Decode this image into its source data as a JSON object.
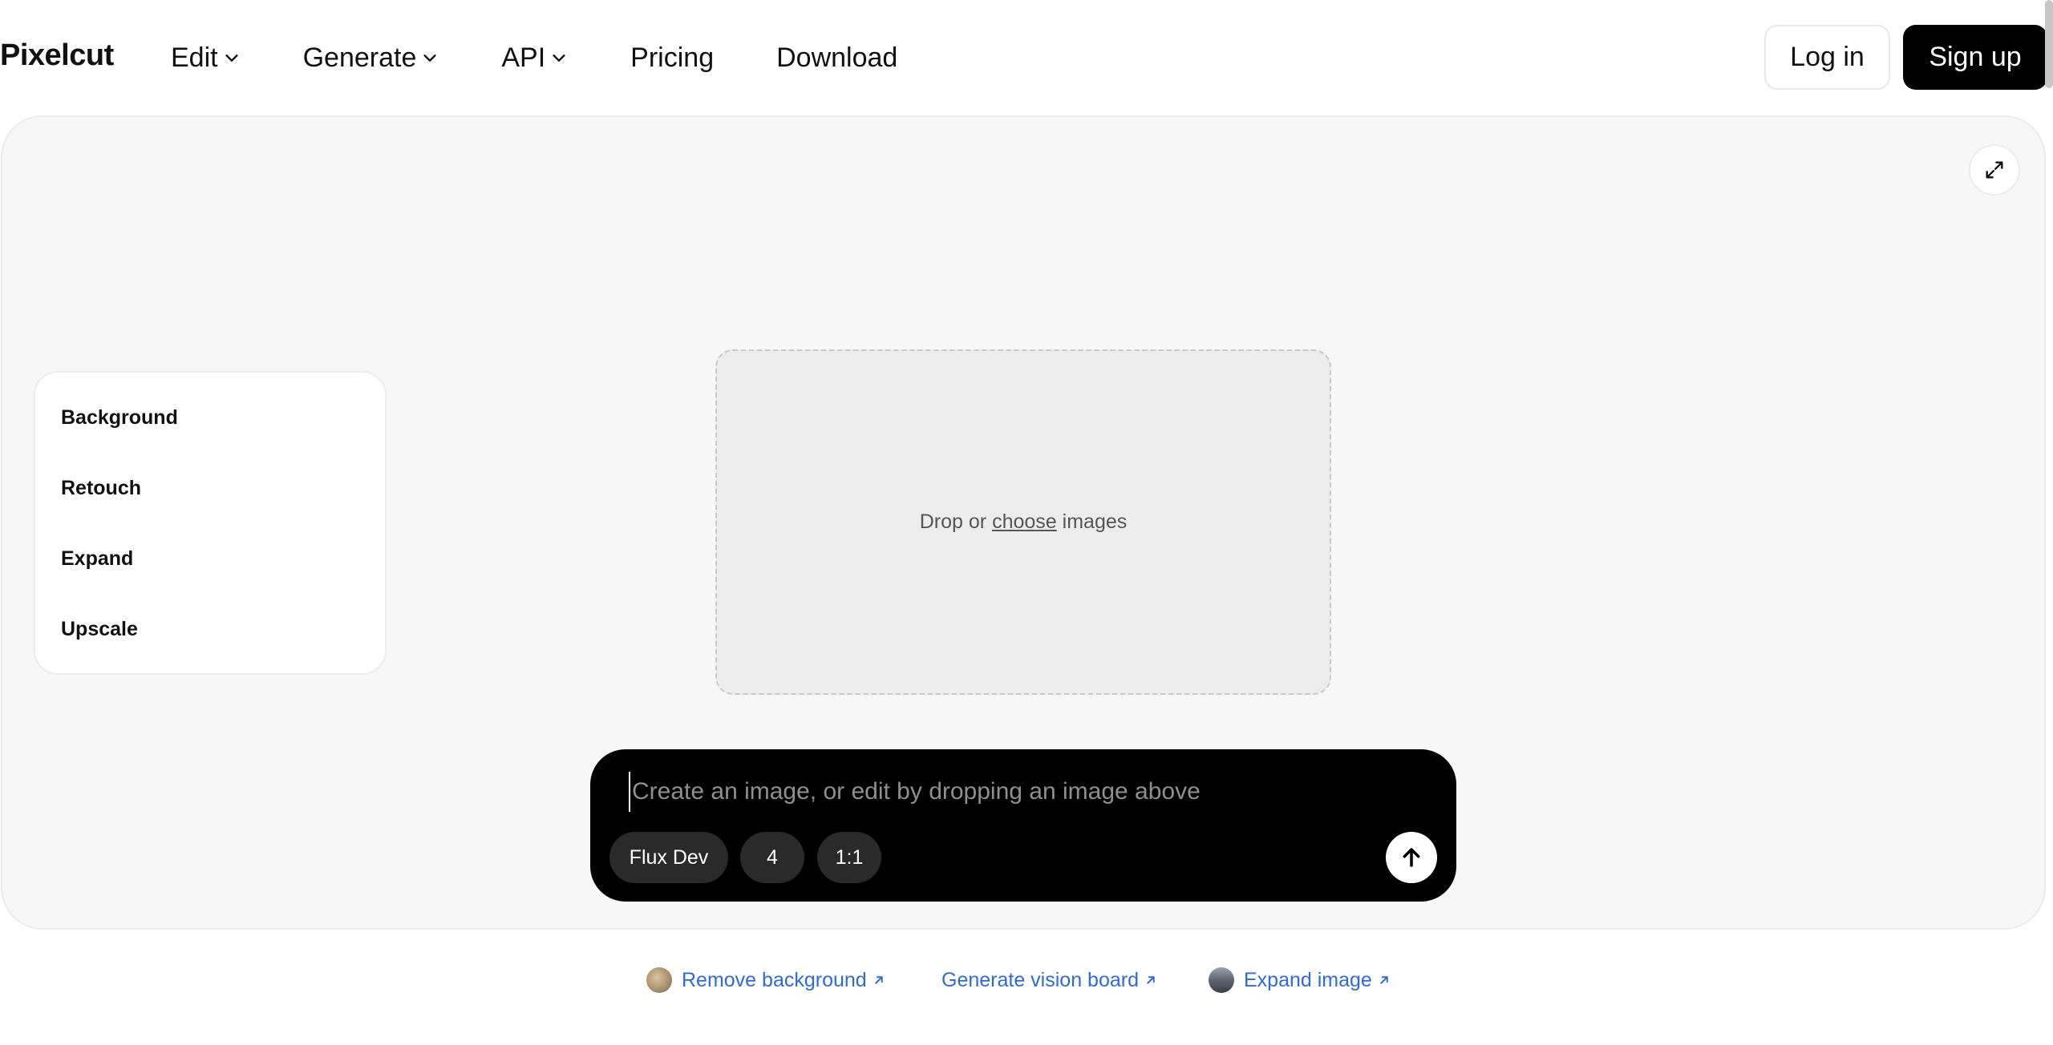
{
  "header": {
    "logo": "Pixelcut",
    "nav": [
      {
        "label": "Edit",
        "has_dropdown": true
      },
      {
        "label": "Generate",
        "has_dropdown": true
      },
      {
        "label": "API",
        "has_dropdown": true
      },
      {
        "label": "Pricing",
        "has_dropdown": false
      },
      {
        "label": "Download",
        "has_dropdown": false
      }
    ],
    "login_label": "Log in",
    "signup_label": "Sign up"
  },
  "workspace": {
    "expand_icon": "expand-arrows-icon",
    "tools": [
      "Background",
      "Retouch",
      "Expand",
      "Upscale"
    ],
    "dropzone": {
      "prefix": "Drop or",
      "link": "choose",
      "suffix": "images"
    }
  },
  "prompt": {
    "placeholder": "Create an image, or edit by dropping an image above",
    "value": "",
    "model": "Flux Dev",
    "count": "4",
    "ratio": "1:1",
    "send_icon": "arrow-up-icon"
  },
  "quick_links": [
    {
      "label": "Remove background",
      "has_thumb": true
    },
    {
      "label": "Generate vision board",
      "has_thumb": false
    },
    {
      "label": "Expand image",
      "has_thumb": true
    }
  ],
  "colors": {
    "link": "#2e6bd6",
    "primary": "#000000",
    "workspace_bg": "#f7f7f7"
  }
}
